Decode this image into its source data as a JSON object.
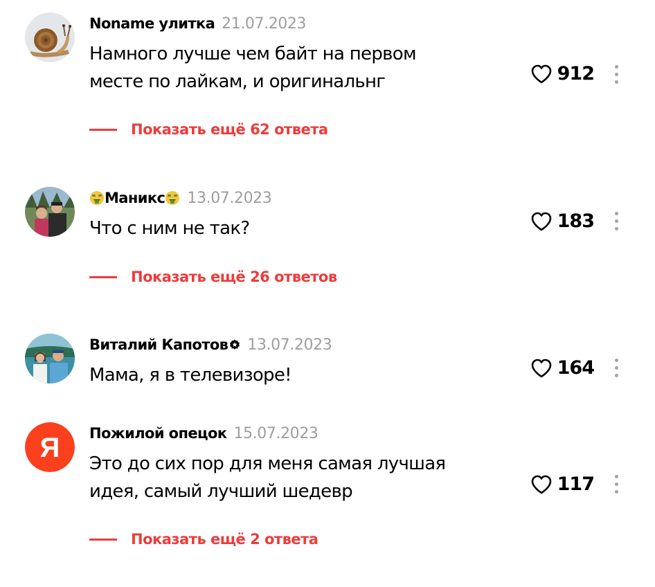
{
  "accent_color": "#ee3b3b",
  "comments": [
    {
      "author": "Noname улитка",
      "date": "21.07.2023",
      "text": [
        "Намного лучше чем байт на первом",
        "месте по лайкам, и оригинальнг"
      ],
      "likes": "912",
      "avatar": "snail-avatar",
      "replies_label": "Показать ещё 62 ответа"
    },
    {
      "author": "Маникс",
      "author_emoji": "money-mouth-face-emoji",
      "date": "13.07.2023",
      "text": [
        "Что с ним не так?"
      ],
      "likes": "183",
      "avatar": "photo-avatar",
      "replies_label": "Показать ещё 26 ответов"
    },
    {
      "author": "Виталий Капотов",
      "author_badge": "verified-badge-icon",
      "date": "13.07.2023",
      "text": [
        "Мама, я в телевизоре!"
      ],
      "likes": "164",
      "avatar": "photo-avatar"
    },
    {
      "author": "Пожилой опецок",
      "date": "15.07.2023",
      "text": [
        "Это до сих пор для меня самая лучшая",
        "идея, самый лучший шедевр"
      ],
      "likes": "117",
      "avatar": "yandex-logo-avatar",
      "avatar_letter": "Я",
      "replies_label": "Показать ещё 2 ответа"
    }
  ]
}
